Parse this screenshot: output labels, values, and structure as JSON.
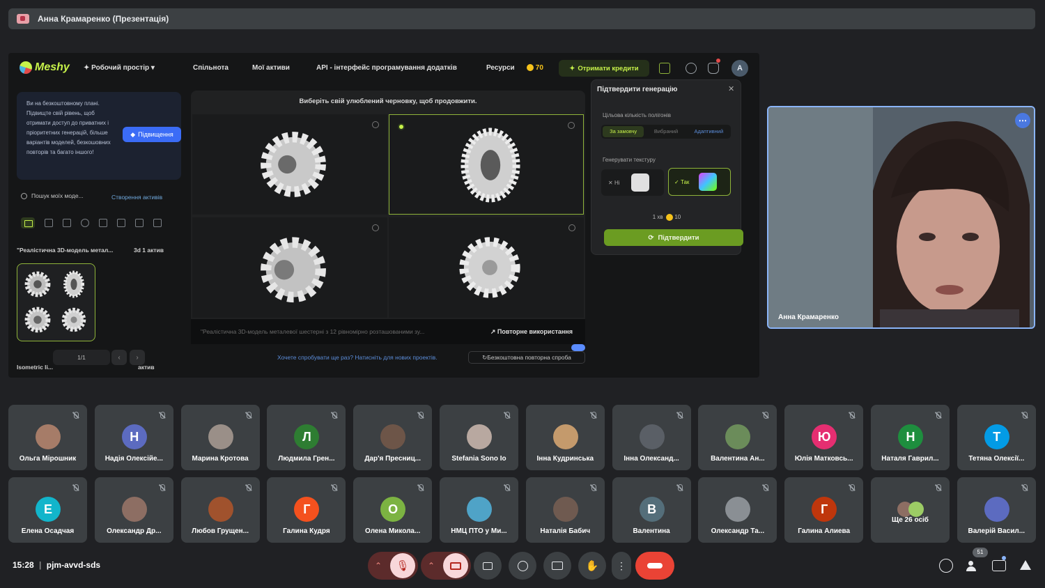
{
  "presenter_bar": {
    "title": "Анна Крамаренко (Презентація)"
  },
  "meshy": {
    "logo": "Meshy",
    "workspace": "Робочий простір",
    "nav": [
      "Спільнота",
      "Мої активи",
      "API - інтерфейс програмування додатків",
      "Ресурси"
    ],
    "coins": "70",
    "get_credits": "Отримати кредити",
    "user_initial": "A",
    "promo_text": "Ви на безкоштовному плані. Підвищте свій рівень, щоб отримати доступ до приватних і пріоритетних генерацій, більше варіантів моделей, безкошовних повторів та багато іншого!",
    "promo_button": "Підвищення",
    "search_placeholder": "Пошук моїх моде...",
    "create_asset": "Створення активів",
    "thread_title": "\"Реалістична 3D-модель метал...",
    "thread_count": "3d 1 актив",
    "pager": "1/1",
    "thread_title2": "Isometric li...",
    "thread_count2": "актив",
    "grid_hint": "Виберіть свій улюблений черновку, щоб продовжити.",
    "prompt_text": "\"Реалістична 3D-модель металевої шестерні з 12 рівномірно розташованими зу...",
    "reuse": "Повторне використання",
    "retry_link": "Хочете спробувати ще раз? Натисніть для нових проектів.",
    "retry_button": "Безкоштовна повторна спроба"
  },
  "confirm_dialog": {
    "title": "Підтвердити генерацію",
    "polycount_label": "Цільова кількість полігонів",
    "seg": [
      "За замовчу",
      "Вибраний",
      "Адаптивний"
    ],
    "texture_label": "Генерувати текстуру",
    "no": "Ні",
    "yes": "Так",
    "cost_prefix": "1 хв",
    "cost_coins": "10",
    "confirm": "Підтвердити"
  },
  "speaker": {
    "name": "Анна Крамаренко"
  },
  "participants_row1": [
    {
      "name": "Ольга Мірошник",
      "initial": "",
      "color": "#a67c68"
    },
    {
      "name": "Надія Олексійе...",
      "initial": "Н",
      "color": "#5c6bc0"
    },
    {
      "name": "Марина Кротова",
      "initial": "",
      "color": "#9a8f88"
    },
    {
      "name": "Людмила Грен...",
      "initial": "Л",
      "color": "#2e7d32"
    },
    {
      "name": "Дар'я Пресниц...",
      "initial": "",
      "color": "#6d5548"
    },
    {
      "name": "Stefania Sono Io",
      "initial": "",
      "color": "#b8a8a0"
    },
    {
      "name": "Інна Кудринська",
      "initial": "",
      "color": "#c49a6c"
    },
    {
      "name": "Інна Олександ...",
      "initial": "",
      "color": "#5a5f66"
    },
    {
      "name": "Валентина Ан...",
      "initial": "",
      "color": "#6b8c5a"
    },
    {
      "name": "Юлія Матковсь...",
      "initial": "Ю",
      "color": "#e52e71"
    },
    {
      "name": "Наталя Гаврил...",
      "initial": "Н",
      "color": "#1e8e3e"
    },
    {
      "name": "Тетяна Олексії...",
      "initial": "Т",
      "color": "#039be5"
    }
  ],
  "participants_row2": [
    {
      "name": "Елена Осадчая",
      "initial": "Е",
      "color": "#12b5cb"
    },
    {
      "name": "Олександр Др...",
      "initial": "",
      "color": "#8d6e63"
    },
    {
      "name": "Любов Грущен...",
      "initial": "",
      "color": "#a0522d"
    },
    {
      "name": "Галина Кудря",
      "initial": "Г",
      "color": "#f4511e"
    },
    {
      "name": "Олена Микола...",
      "initial": "О",
      "color": "#7cb342"
    },
    {
      "name": "НМЦ ПТО у Ми...",
      "initial": "",
      "color": "#4fa3c7"
    },
    {
      "name": "Наталія Бабич",
      "initial": "",
      "color": "#6f5a50"
    },
    {
      "name": "Валентина",
      "initial": "В",
      "color": "#546e7a"
    },
    {
      "name": "Олександр Та...",
      "initial": "",
      "color": "#8a8f94"
    },
    {
      "name": "Галина Алиева",
      "initial": "Г",
      "color": "#bf360c"
    },
    {
      "name": "Ще 26 осіб",
      "initial": "",
      "color": ""
    },
    {
      "name": "Валерій Васил...",
      "initial": "",
      "color": "#5c6bc0"
    }
  ],
  "bottom_bar": {
    "time": "15:28",
    "meeting_code": "pjm-avvd-sds",
    "people_badge": "51"
  }
}
